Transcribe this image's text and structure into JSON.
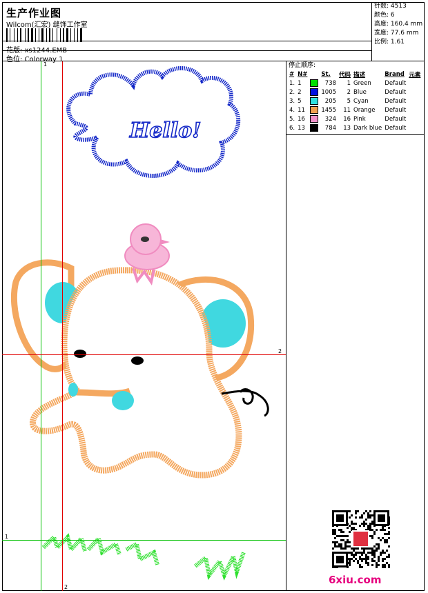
{
  "header": {
    "title": "生产作业图",
    "company": "Wilcom(汇宏) 缝饰工作室",
    "design_label": "花版:",
    "design_value": "xs1244.EMB",
    "colorway_label": "色位:",
    "colorway_value": "Colorway 1"
  },
  "stats": [
    {
      "label": "针数:",
      "value": "4513"
    },
    {
      "label": "颜色:",
      "value": "6"
    },
    {
      "label": "高度:",
      "value": "160.4 mm"
    },
    {
      "label": "宽度:",
      "value": "77.6 mm"
    },
    {
      "label": "比例:",
      "value": "1.61"
    }
  ],
  "stop_sequence": {
    "title": "停止顺序:",
    "headers": [
      "#",
      "N#",
      "St.",
      "代码",
      "描述",
      "Brand",
      "元素"
    ],
    "rows": [
      {
        "num": "1.",
        "n": "1",
        "st": "738",
        "code": "1",
        "desc": "Green",
        "brand": "Default",
        "color": "#00e000"
      },
      {
        "num": "2.",
        "n": "2",
        "st": "1005",
        "code": "2",
        "desc": "Blue",
        "brand": "Default",
        "color": "#0010e0"
      },
      {
        "num": "3.",
        "n": "5",
        "st": "205",
        "code": "5",
        "desc": "Cyan",
        "brand": "Default",
        "color": "#30e0e0"
      },
      {
        "num": "4.",
        "n": "11",
        "st": "1455",
        "code": "11",
        "desc": "Orange",
        "brand": "Default",
        "color": "#f0a050"
      },
      {
        "num": "5.",
        "n": "16",
        "st": "324",
        "code": "16",
        "desc": "Pink",
        "brand": "Default",
        "color": "#f090c8"
      },
      {
        "num": "6.",
        "n": "13",
        "st": "784",
        "code": "13",
        "desc": "Dark blue",
        "brand": "Default",
        "color": "#000000"
      }
    ]
  },
  "canvas": {
    "hello_text": "Hello!",
    "guide_labels": [
      "1",
      "2",
      "2",
      "1"
    ]
  },
  "watermark": "6xiu.com",
  "colors": {
    "guide_green": "#00c000",
    "guide_red": "#e00000",
    "blue_thread": "#1428c8",
    "orange_thread": "#f4a860",
    "cyan_thread": "#40d8e0",
    "pink_thread": "#f08cc0",
    "green_thread": "#30e030"
  }
}
